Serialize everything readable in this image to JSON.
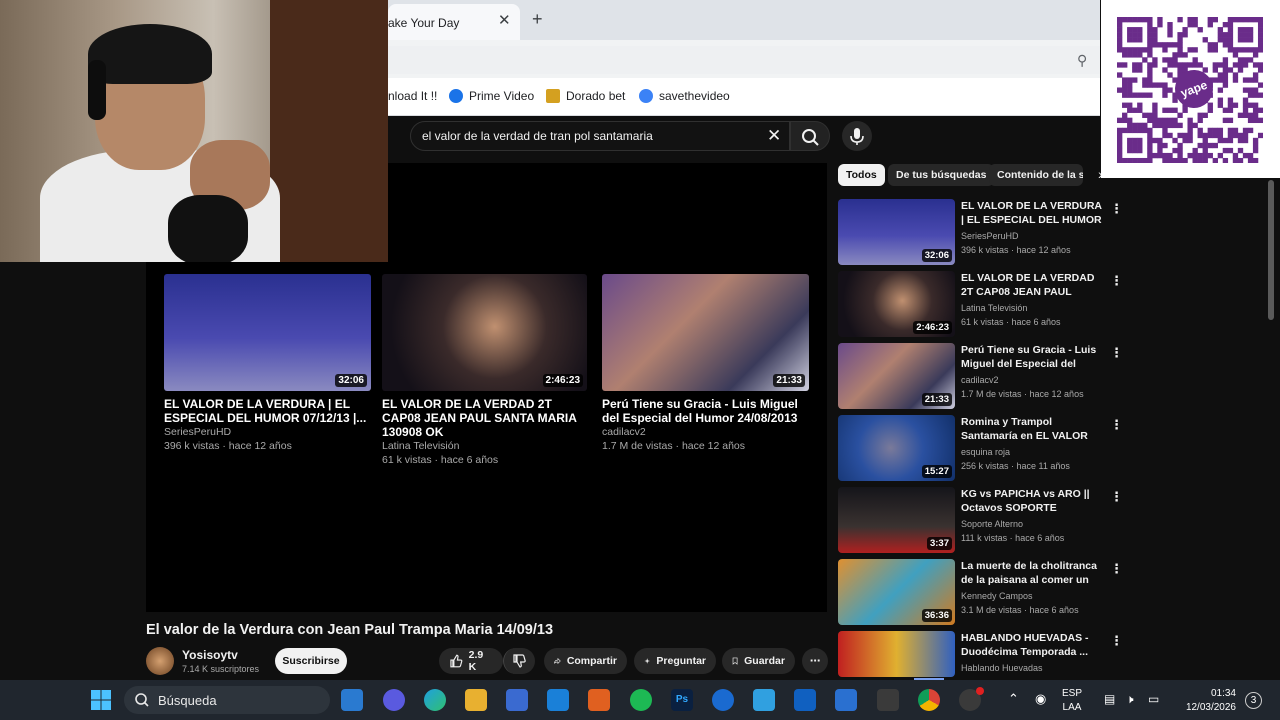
{
  "browser": {
    "tab_title": "ake Your Day",
    "bookmarks": [
      {
        "label": "nload It !!",
        "color": "#4a4a4a"
      },
      {
        "label": "Prime Video",
        "color": "#1a73e8"
      },
      {
        "label": "Dorado bet",
        "color": "#d4a020"
      },
      {
        "label": "savethevideo",
        "color": "#3b82f6"
      }
    ]
  },
  "search": {
    "query": "el valor de la verdad de tran pol santamaria"
  },
  "qr": {
    "brand": "yape"
  },
  "endscreen": [
    {
      "title": "EL VALOR DE LA VERDURA | EL ESPECIAL DEL HUMOR 07/12/13 |...",
      "channel": "SeriesPeruHD",
      "meta": "396 k vistas · hace 12 años",
      "duration": "32:06",
      "color": "#3a3e8a"
    },
    {
      "title": "EL VALOR DE LA VERDAD 2T CAP08 JEAN PAUL SANTA MARIA 130908 OK",
      "channel": "Latina Televisión",
      "meta": "61 k vistas · hace 6 años",
      "duration": "2:46:23",
      "color": "#1a1620"
    },
    {
      "title": "Perú Tiene su Gracia - Luis Miguel del Especial del Humor 24/08/2013",
      "channel": "cadilacv2",
      "meta": "1.7 M de vistas · hace 12 años",
      "duration": "21:33",
      "color": "#5a4a6a"
    }
  ],
  "video": {
    "title": "El valor de la Verdura con Jean Paul Trampa Maria 14/09/13",
    "channel": "Yosisoytv",
    "subscribers": "7.14 K suscriptores",
    "subscribe_label": "Suscribirse",
    "likes": "2.9 K",
    "share_label": "Compartir",
    "ask_label": "Preguntar",
    "save_label": "Guardar"
  },
  "chips": [
    "Todos",
    "De tus búsquedas",
    "Contenido de la se"
  ],
  "sidebar": [
    {
      "title": "EL VALOR DE LA VERDURA | EL ESPECIAL DEL HUMOR ...",
      "channel": "SeriesPeruHD",
      "meta": "396 k vistas · hace 12 años",
      "duration": "32:06",
      "color": "#3a3e8a"
    },
    {
      "title": "EL VALOR DE LA VERDAD 2T CAP08 JEAN PAUL SANTA ...",
      "channel": "Latina Televisión",
      "meta": "61 k vistas · hace 6 años",
      "duration": "2:46:23",
      "color": "#1e1a24"
    },
    {
      "title": "Perú Tiene su Gracia - Luis Miguel del Especial del Humor...",
      "channel": "cadilacv2",
      "meta": "1.7 M de vistas · hace 12 años",
      "duration": "21:33",
      "color": "#5a4a6a"
    },
    {
      "title": "Romina y Trampol Santamaría en EL VALOR DE LA VERDURA...",
      "channel": "esquina roja",
      "meta": "256 k vistas · hace 11 años",
      "duration": "15:27",
      "color": "#2a50a0"
    },
    {
      "title": "KG vs PAPICHA vs ARO || Octavos SOPORTE ALTERNO",
      "channel": "Soporte Alterno",
      "meta": "111 k vistas · hace 6 años",
      "duration": "3:37",
      "color": "#2a2420"
    },
    {
      "title": "La muerte de la cholitranca de la paisana al comer un tamal",
      "channel": "Kennedy Campos",
      "meta": "3.1 M de vistas · hace 6 años",
      "duration": "36:36",
      "color": "#d07a20"
    },
    {
      "title": "HABLANDO HUEVADAS - Duodécima Temporada ...",
      "channel": "Hablando Huevadas",
      "meta": "",
      "duration": "",
      "color": "#a02020"
    }
  ],
  "taskbar": {
    "search_label": "Búsqueda",
    "lang_top": "ESP",
    "lang_bottom": "LAA",
    "time": "01:34",
    "date": "12/03/2026",
    "notification_count": "3"
  }
}
